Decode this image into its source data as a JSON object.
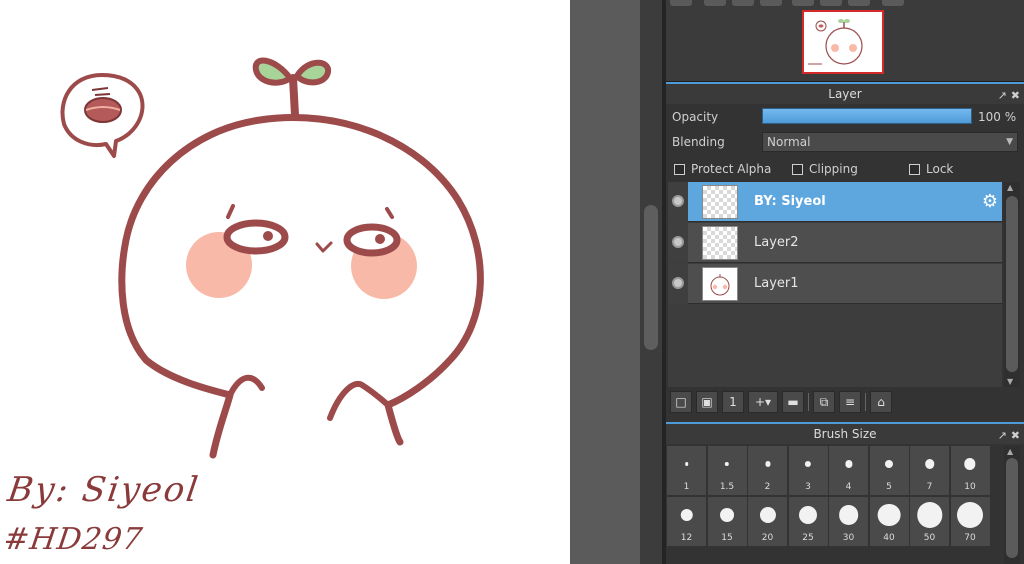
{
  "canvas": {
    "signature_line1": "By: Siyeol",
    "signature_line2": "#HD297",
    "stroke_color": "#9c4a4a",
    "blush_color": "#f9b9a8",
    "leaf_color": "#a8d49a"
  },
  "layer_panel": {
    "title": "Layer",
    "opacity_label": "Opacity",
    "opacity_value": "100 %",
    "opacity_fraction": 1.0,
    "blending_label": "Blending",
    "blending_value": "Normal",
    "protect_alpha_label": "Protect Alpha",
    "clipping_label": "Clipping",
    "lock_label": "Lock",
    "layers": [
      {
        "name": "BY: Siyeol",
        "selected": true
      },
      {
        "name": "Layer2",
        "selected": false
      },
      {
        "name": "Layer1",
        "selected": false
      }
    ],
    "accent_color": "#5ea6de"
  },
  "brush_panel": {
    "title": "Brush Size",
    "sizes": [
      "1",
      "1.5",
      "2",
      "3",
      "4",
      "5",
      "7",
      "10",
      "12",
      "15",
      "20",
      "25",
      "30",
      "40",
      "50",
      "70"
    ]
  }
}
